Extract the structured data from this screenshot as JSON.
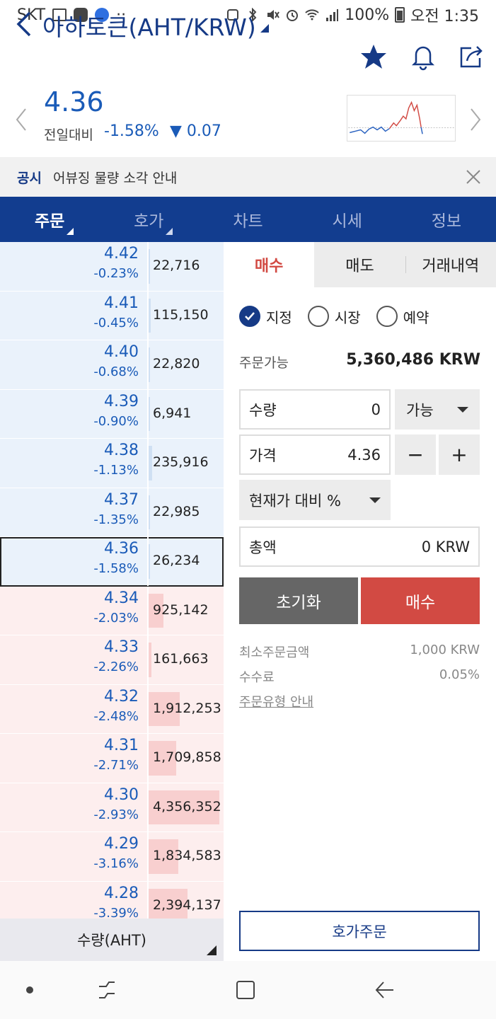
{
  "status_bar": {
    "carrier": "SKT",
    "battery_pct": "100%",
    "time": "오전 1:35",
    "extra": "··"
  },
  "header": {
    "title": "아하토큰(AHT/KRW)",
    "price": "4.36",
    "prev_label": "전일대비",
    "change_pct": "-1.58%",
    "change_abs": "▼ 0.07"
  },
  "notice": {
    "tag": "공시",
    "message": "어뷰징 물량 소각 안내"
  },
  "tabs": [
    {
      "label": "주문"
    },
    {
      "label": "호가"
    },
    {
      "label": "차트"
    },
    {
      "label": "시세"
    },
    {
      "label": "정보"
    }
  ],
  "orderbook": {
    "rows": [
      {
        "price": "4.42",
        "pct": "-0.23%",
        "volume": "22,716",
        "side": "sell",
        "depth": 0.01
      },
      {
        "price": "4.41",
        "pct": "-0.45%",
        "volume": "115,150",
        "side": "sell",
        "depth": 0.03
      },
      {
        "price": "4.40",
        "pct": "-0.68%",
        "volume": "22,820",
        "side": "sell",
        "depth": 0.01
      },
      {
        "price": "4.39",
        "pct": "-0.90%",
        "volume": "6,941",
        "side": "sell",
        "depth": 0.0
      },
      {
        "price": "4.38",
        "pct": "-1.13%",
        "volume": "235,916",
        "side": "sell",
        "depth": 0.05
      },
      {
        "price": "4.37",
        "pct": "-1.35%",
        "volume": "22,985",
        "side": "sell",
        "depth": 0.01
      },
      {
        "price": "4.36",
        "pct": "-1.58%",
        "volume": "26,234",
        "side": "sell",
        "depth": 0.01,
        "current": true
      },
      {
        "price": "4.34",
        "pct": "-2.03%",
        "volume": "925,142",
        "side": "buy",
        "depth": 0.21
      },
      {
        "price": "4.33",
        "pct": "-2.26%",
        "volume": "161,663",
        "side": "buy",
        "depth": 0.04
      },
      {
        "price": "4.32",
        "pct": "-2.48%",
        "volume": "1,912,253",
        "side": "buy",
        "depth": 0.44
      },
      {
        "price": "4.31",
        "pct": "-2.71%",
        "volume": "1,709,858",
        "side": "buy",
        "depth": 0.39
      },
      {
        "price": "4.30",
        "pct": "-2.93%",
        "volume": "4,356,352",
        "side": "buy",
        "depth": 1.0
      },
      {
        "price": "4.29",
        "pct": "-3.16%",
        "volume": "1,834,583",
        "side": "buy",
        "depth": 0.42
      },
      {
        "price": "4.28",
        "pct": "-3.39%",
        "volume": "2,394,137",
        "side": "buy",
        "depth": 0.55
      }
    ],
    "footer_label": "수량(AHT)"
  },
  "order_panel": {
    "tabs": [
      {
        "label": "매수"
      },
      {
        "label": "매도"
      },
      {
        "label": "거래내역"
      }
    ],
    "order_types": [
      {
        "label": "지정",
        "selected": true
      },
      {
        "label": "시장",
        "selected": false
      },
      {
        "label": "예약",
        "selected": false
      }
    ],
    "available_label": "주문가능",
    "available_value": "5,360,486 KRW",
    "qty_label": "수량",
    "qty_value": "0",
    "qty_option": "가능",
    "price_label": "가격",
    "price_value": "4.36",
    "minus": "−",
    "plus": "+",
    "pct_select": "현재가 대비 %",
    "total_label": "총액",
    "total_value": "0 KRW",
    "reset_label": "초기화",
    "buy_label": "매수",
    "min_order_label": "최소주문금액",
    "min_order_value": "1,000 KRW",
    "fee_label": "수수료",
    "fee_value": "0.05%",
    "guide_link": "주문유형 안내",
    "hoga_order_label": "호가주문"
  },
  "colors": {
    "brand_navy": "#123d8f",
    "price_blue": "#1a5bb8",
    "buy_red": "#d24a43"
  }
}
